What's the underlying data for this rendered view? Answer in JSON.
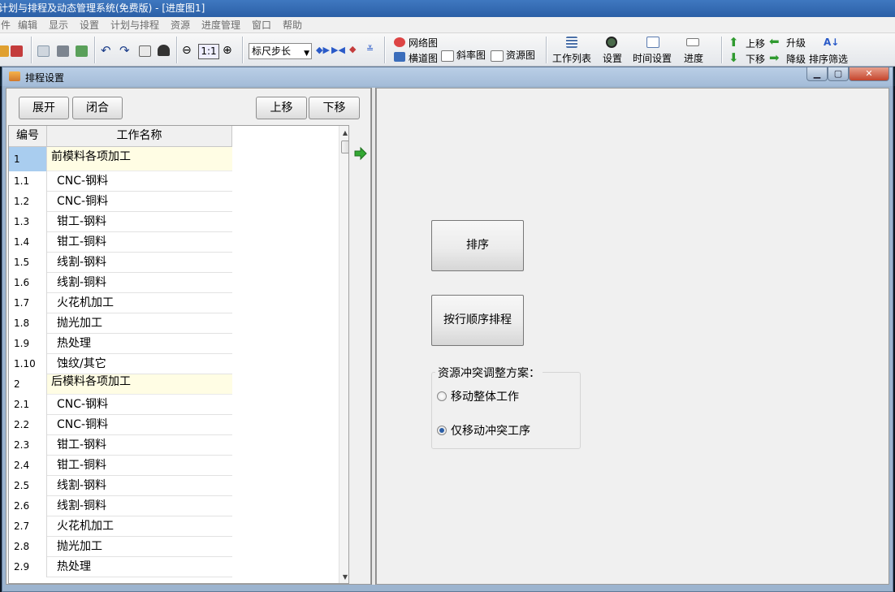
{
  "window": {
    "title": "计划与排程及动态管理系统(免费版) - [进度图1]"
  },
  "menu": [
    "件",
    "编辑",
    "显示",
    "设置",
    "计划与排程",
    "资源",
    "进度管理",
    "窗口",
    "帮助"
  ],
  "toolbar": {
    "zoom_label": "1:1",
    "ruler_select": "标尺步长",
    "network_label": "网络图",
    "horizontal_label": "横道图",
    "slope_label": "斜率图",
    "resource_label": "资源图",
    "worklist_label": "工作列表",
    "settings_label": "设置",
    "time_settings_label": "时间设置",
    "progress_label": "进度",
    "move_up_label": "上移",
    "move_down_label": "下移",
    "promote_label": "升级",
    "demote_label": "降级",
    "sort_filter_label": "排序筛选"
  },
  "dialog": {
    "title": "排程设置",
    "expand_label": "展开",
    "collapse_label": "闭合",
    "up_label": "上移",
    "down_label": "下移",
    "col_no": "编号",
    "col_name": "工作名称",
    "rows": [
      {
        "no": "1",
        "name": "前模料各项加工",
        "group": true,
        "selected": true
      },
      {
        "no": "1.1",
        "name": "CNC-钢料"
      },
      {
        "no": "1.2",
        "name": "CNC-铜料"
      },
      {
        "no": "1.3",
        "name": "钳工-钢料"
      },
      {
        "no": "1.4",
        "name": "钳工-铜料"
      },
      {
        "no": "1.5",
        "name": "线割-钢料"
      },
      {
        "no": "1.6",
        "name": "线割-铜料"
      },
      {
        "no": "1.7",
        "name": "火花机加工"
      },
      {
        "no": "1.8",
        "name": "抛光加工"
      },
      {
        "no": "1.9",
        "name": "热处理"
      },
      {
        "no": "1.10",
        "name": "蚀纹/其它"
      },
      {
        "no": "2",
        "name": "后模料各项加工",
        "group": true
      },
      {
        "no": "2.1",
        "name": "CNC-钢料"
      },
      {
        "no": "2.2",
        "name": "CNC-铜料"
      },
      {
        "no": "2.3",
        "name": "钳工-钢料"
      },
      {
        "no": "2.4",
        "name": "钳工-铜料"
      },
      {
        "no": "2.5",
        "name": "线割-钢料"
      },
      {
        "no": "2.6",
        "name": "线割-铜料"
      },
      {
        "no": "2.7",
        "name": "火花机加工"
      },
      {
        "no": "2.8",
        "name": "抛光加工"
      },
      {
        "no": "2.9",
        "name": "热处理"
      }
    ],
    "sort_label": "排序",
    "sequential_label": "按行顺序排程",
    "conflict_title": "资源冲突调整方案：",
    "option_move_whole": "移动整体工作",
    "option_move_conflict": "仅移动冲突工序",
    "selected_option": "option_move_conflict"
  }
}
